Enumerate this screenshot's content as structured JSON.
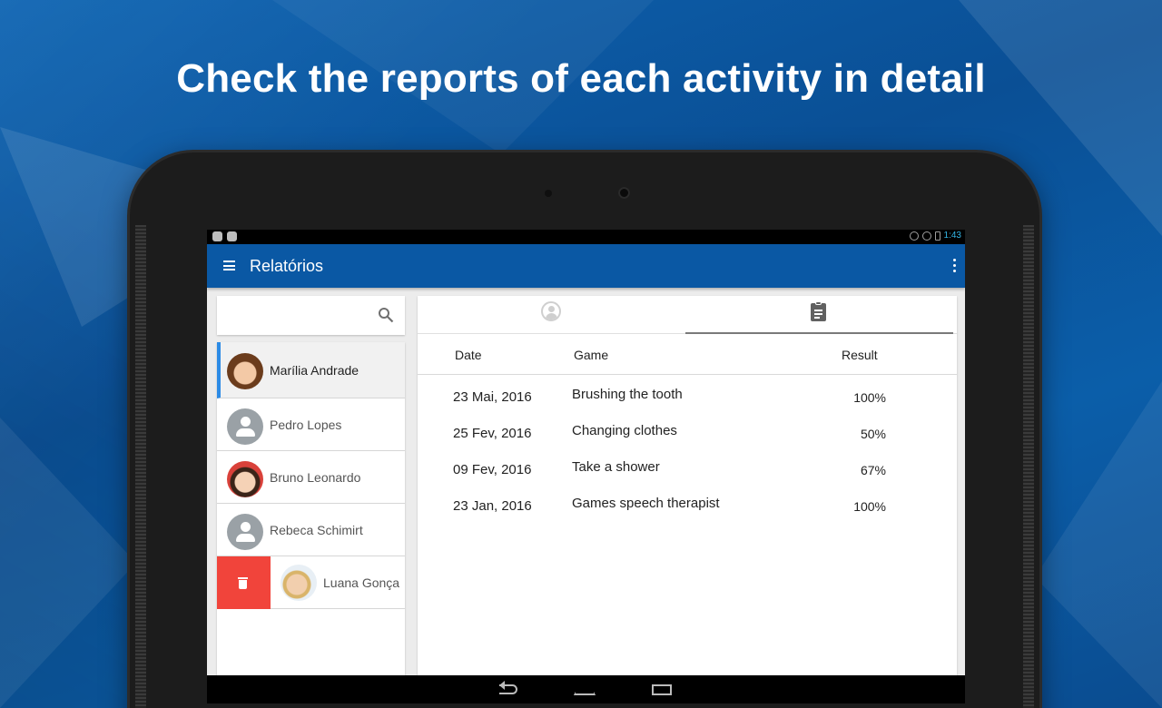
{
  "headline": "Check the reports of each activity in detail",
  "status_bar": {
    "time": "1:43"
  },
  "app_bar": {
    "title": "Relatórios"
  },
  "search": {
    "placeholder": ""
  },
  "students": [
    {
      "name": "Marília Andrade",
      "avatar": "photo",
      "selected": true
    },
    {
      "name": "Pedro Lopes",
      "avatar": "generic-person-icon"
    },
    {
      "name": "Bruno Leonardo",
      "avatar": "photo"
    },
    {
      "name": "Rebeca Schimirt",
      "avatar": "generic-person-icon"
    },
    {
      "name": "Luana Gonça",
      "avatar": "photo",
      "swiped_delete": true
    }
  ],
  "tabs": [
    {
      "icon": "profile-icon",
      "active": false
    },
    {
      "icon": "clipboard-icon",
      "active": true
    }
  ],
  "report_table": {
    "headers": {
      "date": "Date",
      "game": "Game",
      "result": "Result"
    },
    "rows": [
      {
        "date": "23 Mai, 2016",
        "game": "Brushing the tooth",
        "result": "100%"
      },
      {
        "date": "25 Fev, 2016",
        "game": "Changing clothes",
        "result": "50%"
      },
      {
        "date": "09 Fev, 2016",
        "game": "Take a shower",
        "result": "67%"
      },
      {
        "date": "23 Jan, 2016",
        "game": "Games speech therapist",
        "result": "100%"
      }
    ]
  },
  "colors": {
    "app_bar": "#0a58a4",
    "selected_indicator": "#2c8be6",
    "delete": "#f1443b",
    "background": "#0b5ea9"
  }
}
